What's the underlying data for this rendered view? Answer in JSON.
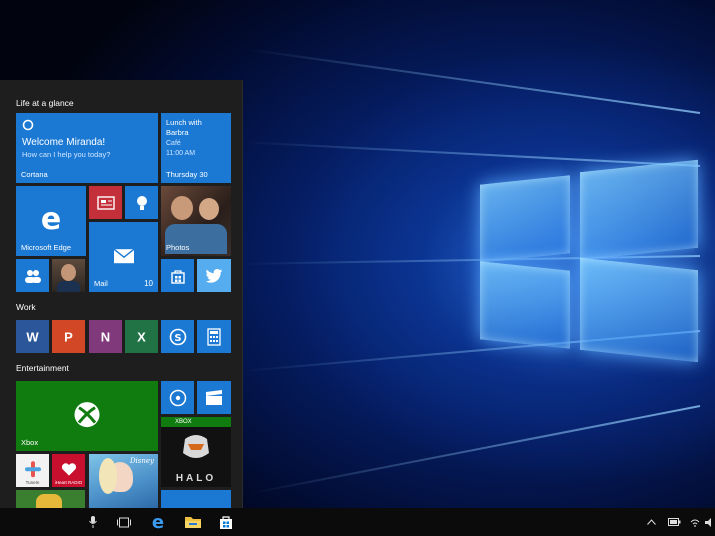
{
  "start_menu": {
    "groups": {
      "life": "Life at a glance",
      "work": "Work",
      "entertainment": "Entertainment"
    },
    "tiles": {
      "cortana": {
        "greeting": "Welcome Miranda!",
        "prompt": "How can I help you today?",
        "label": "Cortana"
      },
      "calendar": {
        "title": "Lunch with",
        "title2": "Barbra",
        "place": "Café",
        "time": "11:00 AM",
        "day": "Thursday 30"
      },
      "edge": {
        "label": "Microsoft Edge"
      },
      "photos": {
        "label": "Photos"
      },
      "mail": {
        "label": "Mail",
        "count": "10"
      },
      "xbox": {
        "label": "Xbox"
      },
      "xbox_badge": "XBOX",
      "halo": "HALO",
      "disney": "Disney",
      "tunein": "TuneIn",
      "iheart": "iHeart RADIO",
      "word": "W",
      "powerpoint": "P",
      "onenote": "N",
      "excel": "X"
    }
  },
  "colors": {
    "accent": "#0078d7",
    "tile_blue": "#1b79d4",
    "xbox_green": "#107c10",
    "start_bg": "#1e1e1e",
    "taskbar_bg": "#0b0b0b"
  }
}
